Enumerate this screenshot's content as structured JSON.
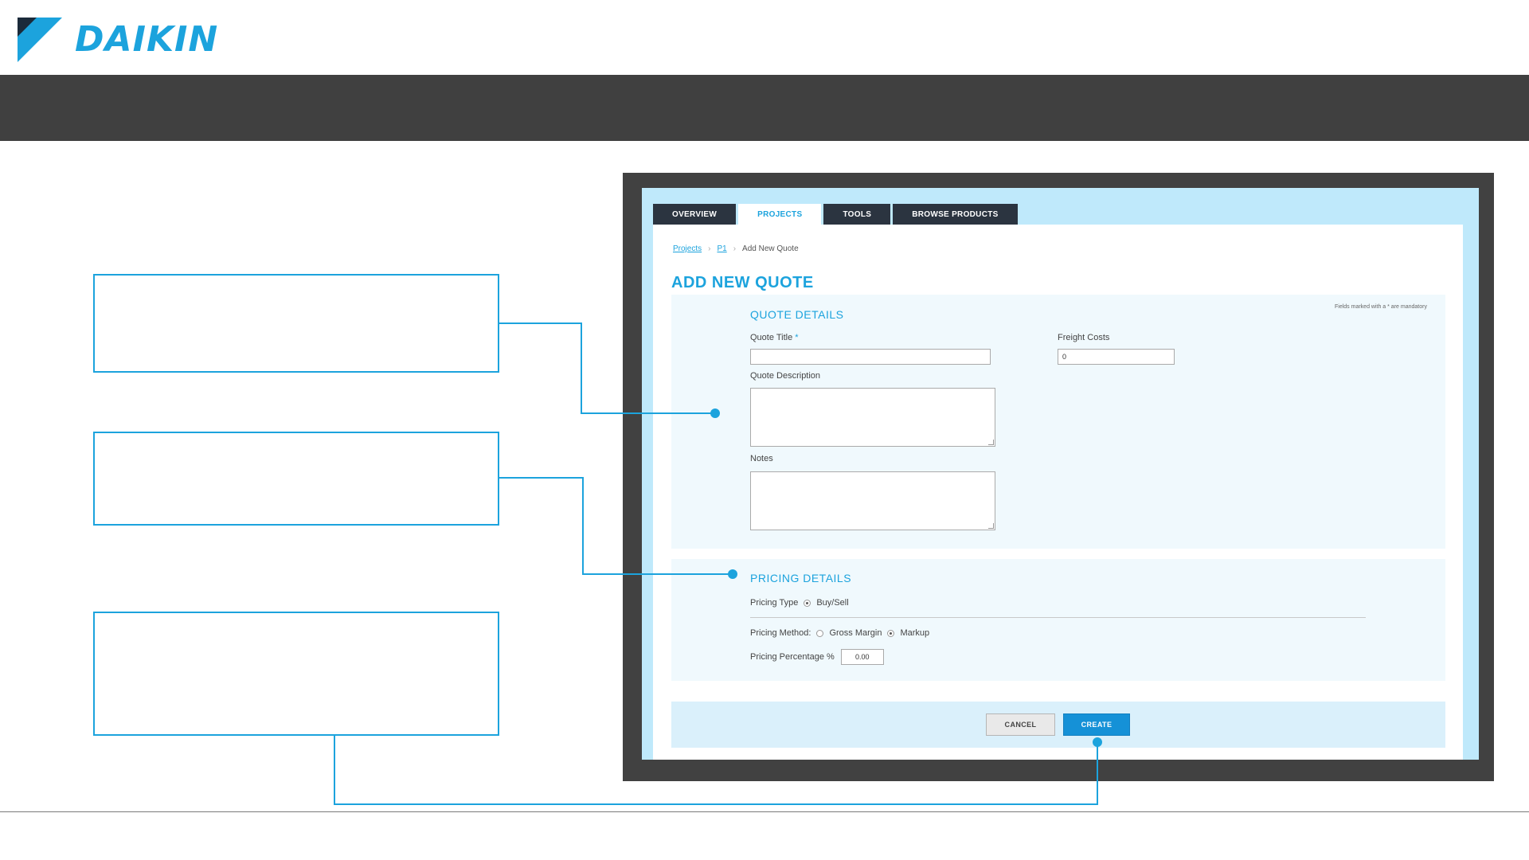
{
  "brand": {
    "name": "DAIKIN",
    "accent": "#1ca3dd",
    "topbar_color": "#404040"
  },
  "app": {
    "tabs": [
      {
        "label": "OVERVIEW",
        "active": false
      },
      {
        "label": "PROJECTS",
        "active": true
      },
      {
        "label": "TOOLS",
        "active": false
      },
      {
        "label": "BROWSE PRODUCTS",
        "active": false
      }
    ],
    "breadcrumb": {
      "items": [
        "Projects",
        "P1"
      ],
      "current": "Add New Quote"
    },
    "page_title": "ADD NEW QUOTE",
    "quote_details": {
      "title": "QUOTE DETAILS",
      "mandatory_note": "Fields marked with a * are mandatory",
      "quote_title_label": "Quote Title",
      "required_marker": "*",
      "quote_title_value": "",
      "freight_costs_label": "Freight Costs",
      "freight_costs_value": "0",
      "quote_description_label": "Quote Description",
      "notes_label": "Notes"
    },
    "pricing_details": {
      "title": "PRICING DETAILS",
      "pricing_type_label": "Pricing Type",
      "pricing_type_option": "Buy/Sell",
      "pricing_method_label": "Pricing Method:",
      "method_options": [
        {
          "label": "Gross Margin",
          "selected": false
        },
        {
          "label": "Markup",
          "selected": true
        }
      ],
      "pricing_percentage_label": "Pricing Percentage %",
      "pricing_percentage_value": "0.00"
    },
    "actions": {
      "cancel_label": "CANCEL",
      "create_label": "CREATE"
    }
  }
}
